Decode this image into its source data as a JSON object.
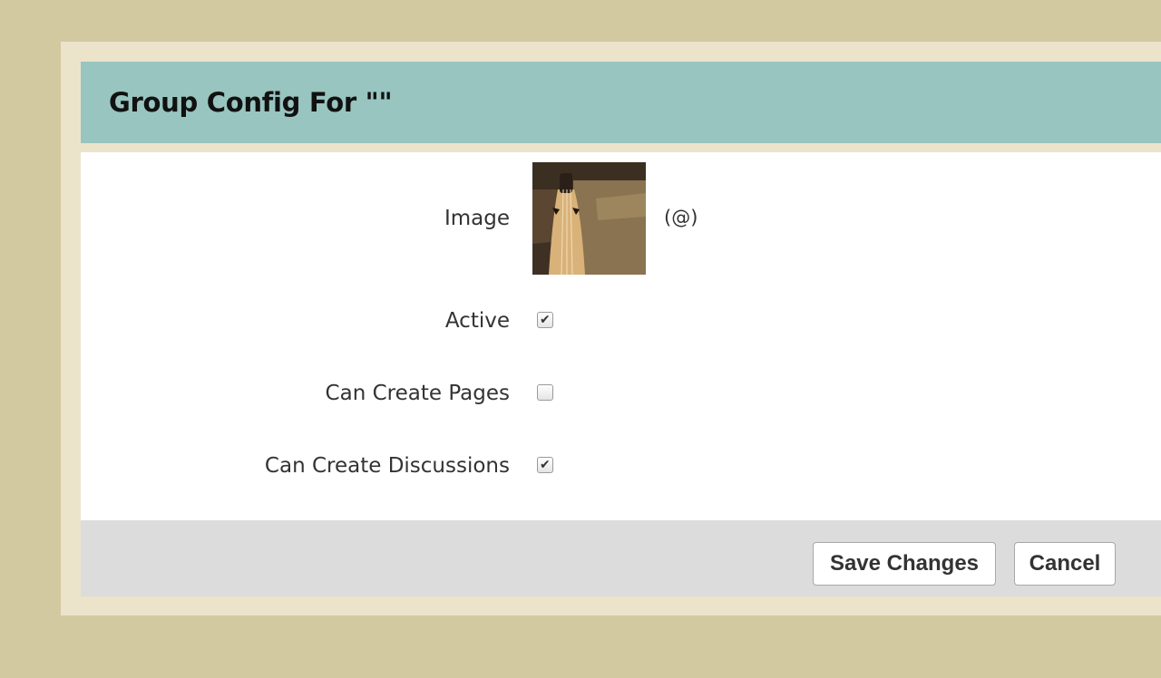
{
  "dialog": {
    "title": "Group Config For \"\""
  },
  "form": {
    "image_label": "Image",
    "image_handle": "(@)",
    "active_label": "Active",
    "active_checked": true,
    "can_create_pages_label": "Can Create Pages",
    "can_create_pages_checked": false,
    "can_create_discussions_label": "Can Create Discussions",
    "can_create_discussions_checked": true
  },
  "footer": {
    "save_label": "Save Changes",
    "cancel_label": "Cancel"
  },
  "colors": {
    "page_background": "#d3c9a1",
    "frame": "#ebe4cb",
    "header": "#98c5bf",
    "footer": "#dcdcdc"
  }
}
